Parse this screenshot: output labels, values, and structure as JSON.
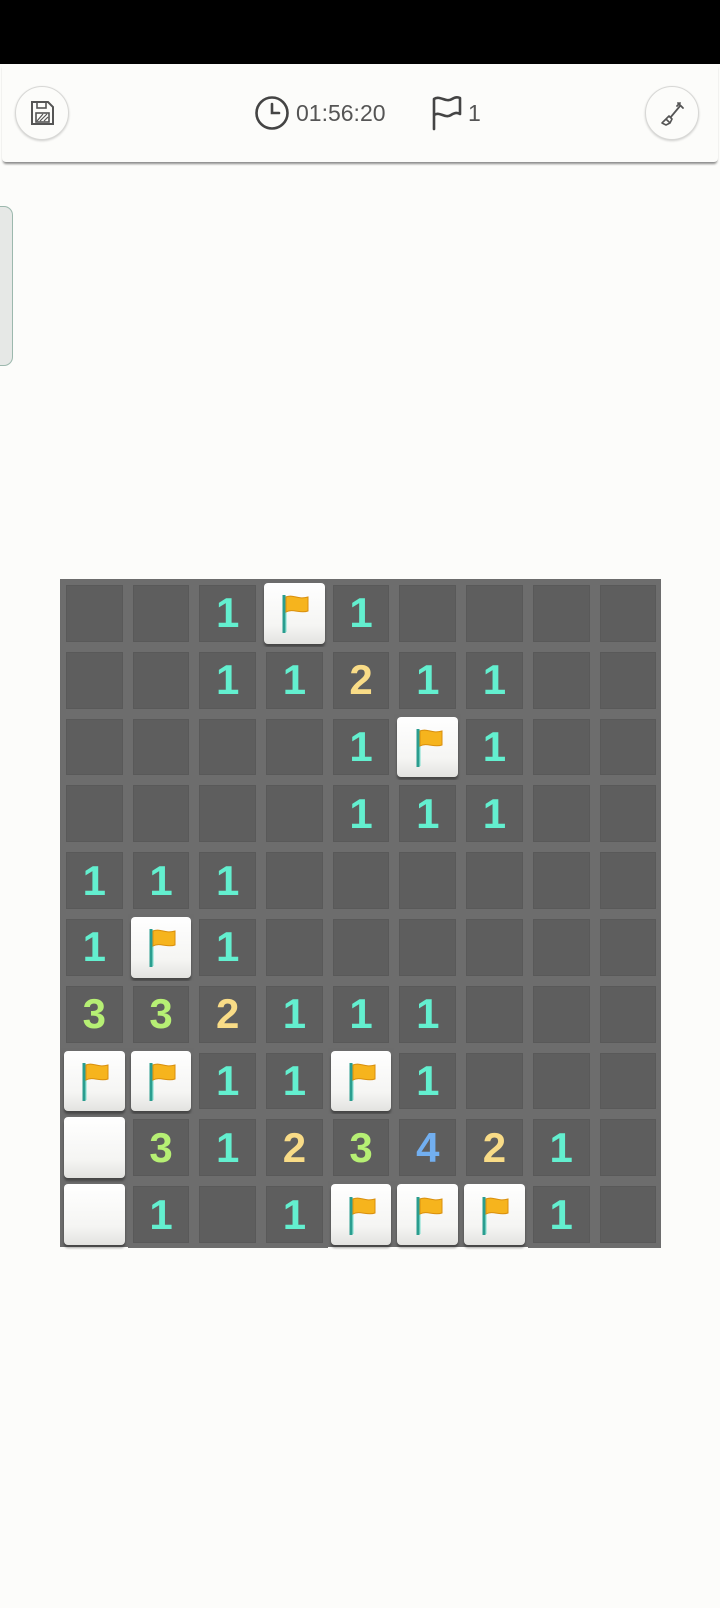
{
  "toolbar": {
    "timer": "01:56:20",
    "flags_remaining": "1",
    "save_icon": "save-icon",
    "timer_icon": "clock-icon",
    "flag_counter_icon": "flag-outline-icon",
    "dig_icon": "shovel-icon"
  },
  "colors": {
    "number_1": "#63efcf",
    "number_2": "#f9dc87",
    "number_3": "#b6ef74",
    "number_4": "#72aff0",
    "flag": "#f6b41d",
    "revealed_cell": "#5e5e5e",
    "covered_cell": "#ffffff"
  },
  "board": {
    "rows": [
      [
        "",
        "",
        "1",
        "F",
        "1",
        "",
        "",
        "",
        ""
      ],
      [
        "",
        "",
        "1",
        "1",
        "2",
        "1",
        "1",
        "",
        ""
      ],
      [
        "",
        "",
        "",
        "",
        "1",
        "F",
        "1",
        "",
        ""
      ],
      [
        "",
        "",
        "",
        "",
        "1",
        "1",
        "1",
        "",
        ""
      ],
      [
        "1",
        "1",
        "1",
        "",
        "",
        "",
        "",
        "",
        ""
      ],
      [
        "1",
        "F",
        "1",
        "",
        "",
        "",
        "",
        "",
        ""
      ],
      [
        "3",
        "3",
        "2",
        "1",
        "1",
        "1",
        "",
        "",
        ""
      ],
      [
        "F",
        "F",
        "1",
        "1",
        "F",
        "1",
        "",
        "",
        ""
      ],
      [
        "#",
        "3",
        "1",
        "2",
        "3",
        "4",
        "2",
        "1",
        ""
      ],
      [
        "#",
        "1",
        "",
        "1",
        "F",
        "F",
        "F",
        "1",
        ""
      ]
    ]
  }
}
